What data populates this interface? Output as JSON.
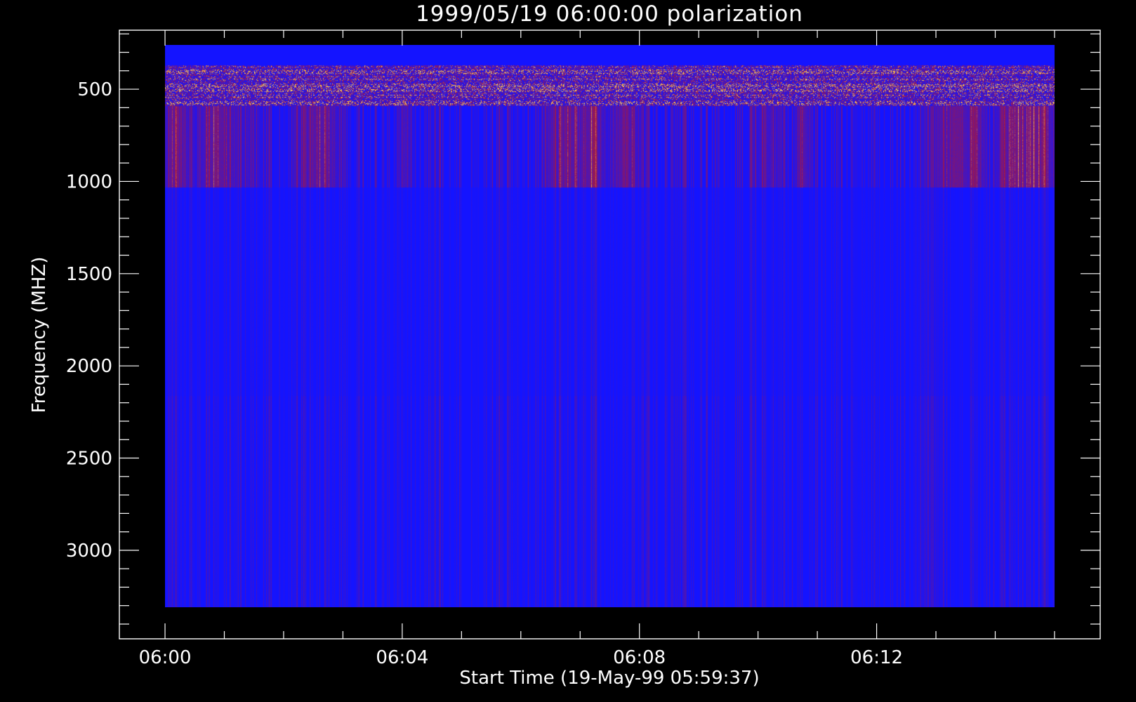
{
  "chart_data": {
    "type": "heatmap",
    "title": "1999/05/19 06:00:00 polarization",
    "xlabel": "Start Time (19-May-99 05:59:37)",
    "ylabel": "Frequency (MHZ)",
    "x_tick_labels": [
      "06:00",
      "06:04",
      "06:08",
      "06:12"
    ],
    "x_tick_minutes": [
      0,
      4,
      8,
      12
    ],
    "x_minor_tick_minutes": [
      1,
      2,
      3,
      5,
      6,
      7,
      9,
      10,
      11,
      13,
      14,
      15
    ],
    "x_data_range_minutes": [
      0,
      15
    ],
    "x_axis_range_minutes": [
      -0.77,
      15.77
    ],
    "y_tick_values": [
      500,
      1000,
      1500,
      2000,
      2500,
      3000
    ],
    "y_tick_labels": [
      "500",
      "1000",
      "1500",
      "2000",
      "2500",
      "3000"
    ],
    "y_minor_step": 100,
    "y_axis_range": [
      180,
      3480
    ],
    "y_reversed": true,
    "frequency_bands_mhz": [
      {
        "from": 260,
        "to": 370,
        "pattern": "uniform",
        "level": 0.0
      },
      {
        "from": 370,
        "to": 590,
        "pattern": "noisy-bright",
        "level": 0.55
      },
      {
        "from": 590,
        "to": 1030,
        "pattern": "time-bursts",
        "level": 0.35
      },
      {
        "from": 1030,
        "to": 2160,
        "pattern": "striated",
        "level": 0.15
      },
      {
        "from": 2160,
        "to": 3310,
        "pattern": "striated",
        "level": 0.22
      }
    ],
    "colors": {
      "background": "#000000",
      "axes": "#ffffff",
      "low": "#1414ff",
      "mid": "#a0164a",
      "high": "#ffcc55"
    },
    "grid": false,
    "legend": "none"
  }
}
